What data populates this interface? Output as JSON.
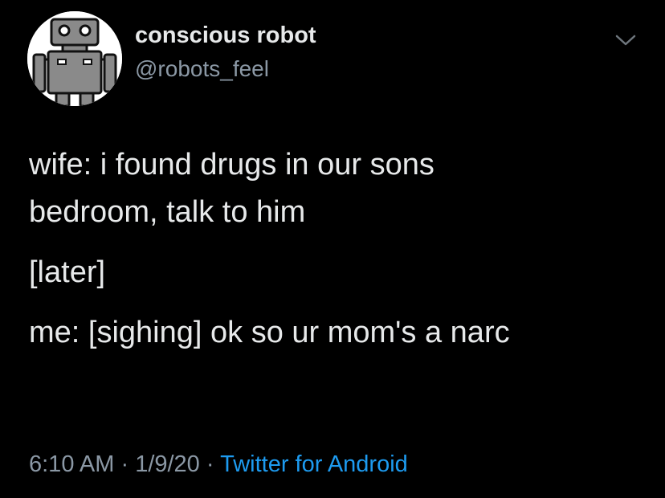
{
  "user": {
    "display_name": "conscious robot",
    "handle": "@robots_feel",
    "avatar_icon": "robot-avatar-icon"
  },
  "menu": {
    "icon": "chevron-down-icon"
  },
  "tweet": {
    "lines": [
      "wife: i found drugs in our sons",
      "bedroom, talk to him",
      "[later]",
      "me: [sighing] ok so ur mom's a narc"
    ]
  },
  "meta": {
    "time": "6:10 AM",
    "separator": " · ",
    "date": "1/9/20",
    "source": "Twitter for Android"
  },
  "colors": {
    "background": "#000000",
    "text": "#e7e9ea",
    "secondary_text": "#8b98a5",
    "link": "#1d9bf0"
  }
}
